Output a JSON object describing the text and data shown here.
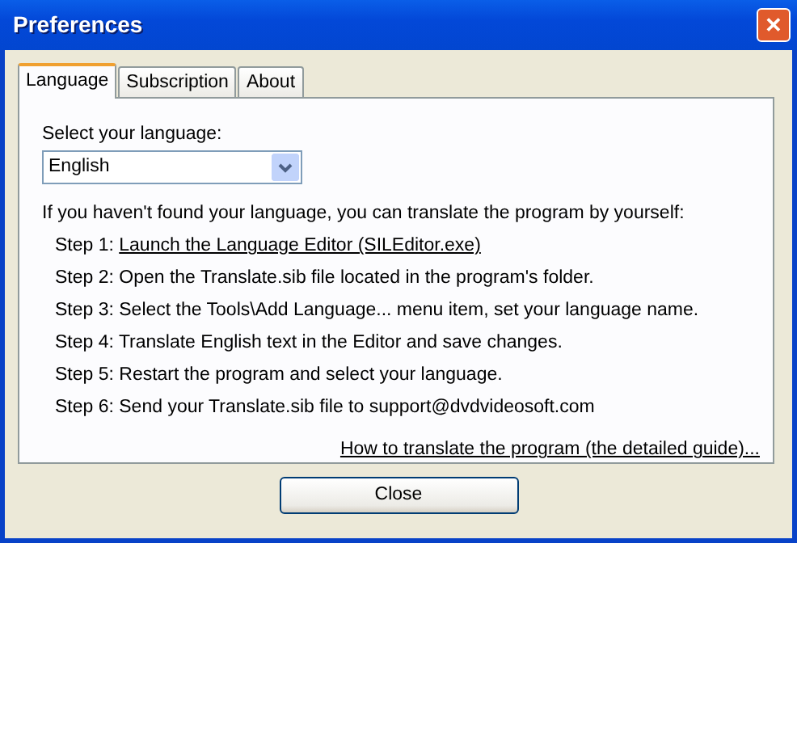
{
  "window": {
    "title": "Preferences",
    "close_symbol": "✕"
  },
  "tabs": [
    {
      "label": "Language",
      "selected": true
    },
    {
      "label": "Subscription",
      "selected": false
    },
    {
      "label": "About",
      "selected": false
    }
  ],
  "language": {
    "label": "Select your language:",
    "value": "English"
  },
  "intro": "If you haven't found your language, you can translate the program by yourself:",
  "steps": [
    {
      "prefix": "Step 1:",
      "text": "Launch the Language Editor (SILEditor.exe)",
      "kind": "link"
    },
    {
      "prefix": "Step 2:",
      "text": "Open the Translate.sib file located in the program's folder.",
      "kind": "text"
    },
    {
      "prefix": "Step 3:",
      "text": "Select the Tools\\Add Language... menu item, set your language name.",
      "kind": "text"
    },
    {
      "prefix": "Step 4:",
      "text": "Translate English text in the Editor and save changes.",
      "kind": "text"
    },
    {
      "prefix": "Step 5:",
      "text": "Restart the program and select your language.",
      "kind": "text"
    },
    {
      "prefix": "Step 6:",
      "text": "Send your Translate.sib file to support@dvdvideosoft.com",
      "kind": "text"
    }
  ],
  "guide_link": "How to translate the program (the detailed guide)...",
  "buttons": [
    {
      "label": "Close"
    }
  ]
}
